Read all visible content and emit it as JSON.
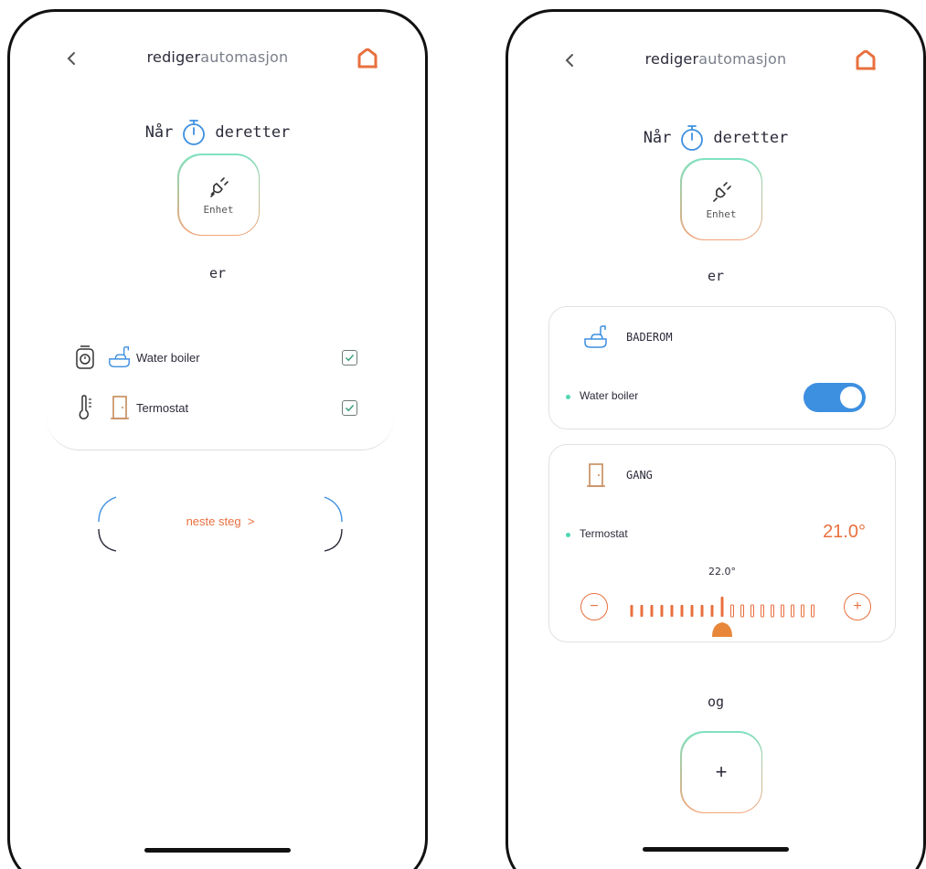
{
  "screens": [
    {
      "header": {
        "title_bold": "rediger",
        "title_light": "automasjon"
      },
      "trigger": {
        "when_label": "Når",
        "then_label": "deretter"
      },
      "device_tile": {
        "label": "Enhet"
      },
      "condition_label": "er",
      "devices": [
        {
          "name": "Water boiler",
          "checked": true
        },
        {
          "name": "Termostat",
          "checked": true
        }
      ],
      "next_step": {
        "label": "neste steg",
        "arrow": ">"
      }
    },
    {
      "header": {
        "title_bold": "rediger",
        "title_light": "automasjon"
      },
      "trigger": {
        "when_label": "Når",
        "then_label": "deretter"
      },
      "device_tile": {
        "label": "Enhet"
      },
      "condition_label": "er",
      "rooms": [
        {
          "name": "BADEROM",
          "device": "Water boiler",
          "toggle_on": true
        },
        {
          "name": "GANG",
          "device": "Termostat",
          "temperature": "21.0°",
          "setpoint": "22.0°",
          "minus": "−",
          "plus": "+"
        }
      ],
      "and_label": "og",
      "add_button": {
        "label": "+"
      }
    }
  ],
  "colors": {
    "accent": "#e8703f",
    "toggle": "#3d8fe0",
    "status_dot": "#4fd7b1",
    "tile_gradient_top": "#7ee2bf",
    "tile_gradient_bottom": "#f2a47a"
  }
}
